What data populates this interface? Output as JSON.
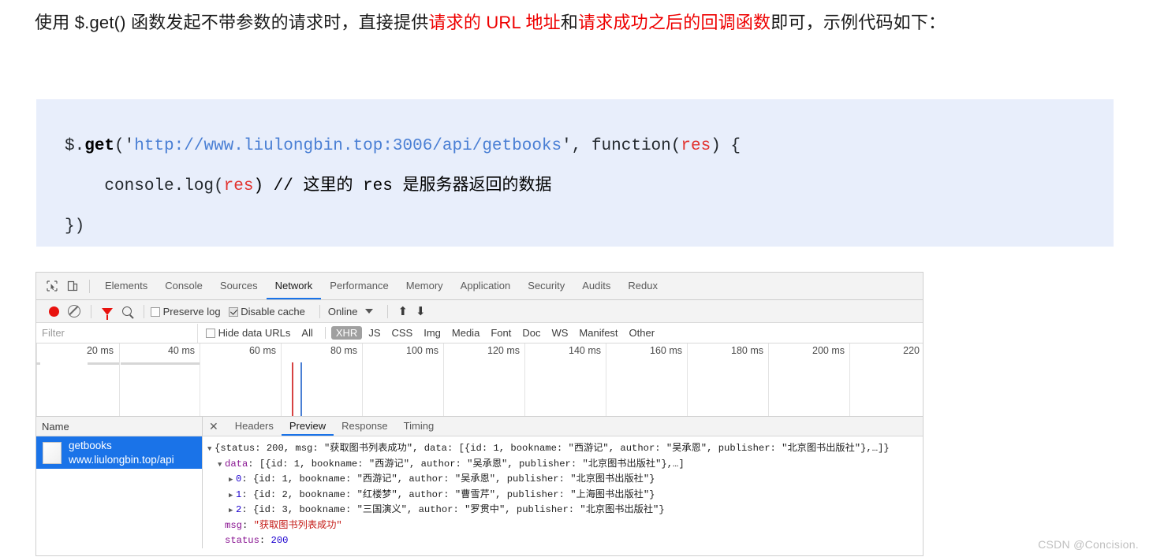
{
  "article": {
    "seg1": "使用 $.get() 函数发起不带参数的请求时，直接提供",
    "hl1": "请求的 URL 地址",
    "seg2": "和",
    "hl2": "请求成功之后的回调函数",
    "seg3": "即可，示例代码如下：",
    "highlight_color": "#ee0000"
  },
  "code": {
    "line1_a": "$.",
    "line1_b": "get",
    "line1_c": "('",
    "line1_url": "http://www.liulongbin.top:3006/api/getbooks",
    "line1_d": "', function(",
    "line1_res": "res",
    "line1_e": ") {",
    "line2_a": "    console.log(",
    "line2_res": "res",
    "line2_b": ") // 这里的 res 是服务器返回的数据",
    "line3": "})",
    "bg_color": "#e8eefb"
  },
  "devtools": {
    "tabs": [
      {
        "label": "Elements",
        "active": false
      },
      {
        "label": "Console",
        "active": false
      },
      {
        "label": "Sources",
        "active": false
      },
      {
        "label": "Network",
        "active": true
      },
      {
        "label": "Performance",
        "active": false
      },
      {
        "label": "Memory",
        "active": false
      },
      {
        "label": "Application",
        "active": false
      },
      {
        "label": "Security",
        "active": false
      },
      {
        "label": "Audits",
        "active": false
      },
      {
        "label": "Redux",
        "active": false
      }
    ],
    "toolbar": {
      "record_title": "record-button",
      "clear_title": "clear-button",
      "filter_title": "filter-button",
      "search_title": "search-button",
      "preserve_log_label": "Preserve log",
      "preserve_log_checked": false,
      "disable_cache_label": "Disable cache",
      "disable_cache_checked": true,
      "throttle_value": "Online",
      "import_title": "import-har",
      "export_title": "export-har",
      "record_color": "#e8120e",
      "filter_color": "#e8120e"
    },
    "filterbar": {
      "filter_placeholder": "Filter",
      "filter_value": "",
      "hide_data_urls_label": "Hide data URLs",
      "hide_data_urls_checked": false,
      "types": [
        {
          "label": "All",
          "selected": false
        },
        {
          "label": "XHR",
          "selected": true
        },
        {
          "label": "JS",
          "selected": false
        },
        {
          "label": "CSS",
          "selected": false
        },
        {
          "label": "Img",
          "selected": false
        },
        {
          "label": "Media",
          "selected": false
        },
        {
          "label": "Font",
          "selected": false
        },
        {
          "label": "Doc",
          "selected": false
        },
        {
          "label": "WS",
          "selected": false
        },
        {
          "label": "Manifest",
          "selected": false
        },
        {
          "label": "Other",
          "selected": false
        }
      ]
    },
    "overview": {
      "ticks": [
        "20 ms",
        "40 ms",
        "60 ms",
        "80 ms",
        "100 ms",
        "120 ms",
        "140 ms",
        "160 ms",
        "180 ms",
        "200 ms",
        "220"
      ],
      "dom_content_loaded_color": "#d64242",
      "load_color": "#4a7fd4"
    },
    "name_column": {
      "header": "Name",
      "rows": [
        {
          "name": "getbooks",
          "domain": "www.liulongbin.top/api",
          "selected": true
        }
      ]
    },
    "sub_tabs": [
      {
        "label": "Headers",
        "active": false
      },
      {
        "label": "Preview",
        "active": true
      },
      {
        "label": "Response",
        "active": false
      },
      {
        "label": "Timing",
        "active": false
      }
    ],
    "preview": {
      "line0": {
        "indent": 0,
        "arrow": "▼",
        "text": "{status: 200, msg: \"获取图书列表成功\", data: [{id: 1, bookname: \"西游记\", author: \"吴承恩\", publisher: \"北京图书出版社\"},…]}"
      },
      "line1": {
        "indent": 1,
        "arrow": "▼",
        "key": "data",
        "text": ": [{id: 1, bookname: \"西游记\", author: \"吴承恩\", publisher: \"北京图书出版社\"},…]"
      },
      "items": [
        {
          "index": "0",
          "arrow": "▶",
          "text": ": {id: 1, bookname: \"西游记\", author: \"吴承恩\", publisher: \"北京图书出版社\"}"
        },
        {
          "index": "1",
          "arrow": "▶",
          "text": ": {id: 2, bookname: \"红楼梦\", author: \"曹雪芹\", publisher: \"上海图书出版社\"}"
        },
        {
          "index": "2",
          "arrow": "▶",
          "text": ": {id: 3, bookname: \"三国演义\", author: \"罗贯中\", publisher: \"北京图书出版社\"}"
        }
      ],
      "msg_key": "msg",
      "msg_val": "\"获取图书列表成功\"",
      "status_key": "status",
      "status_val": "200"
    }
  },
  "watermark": "CSDN @Concision."
}
